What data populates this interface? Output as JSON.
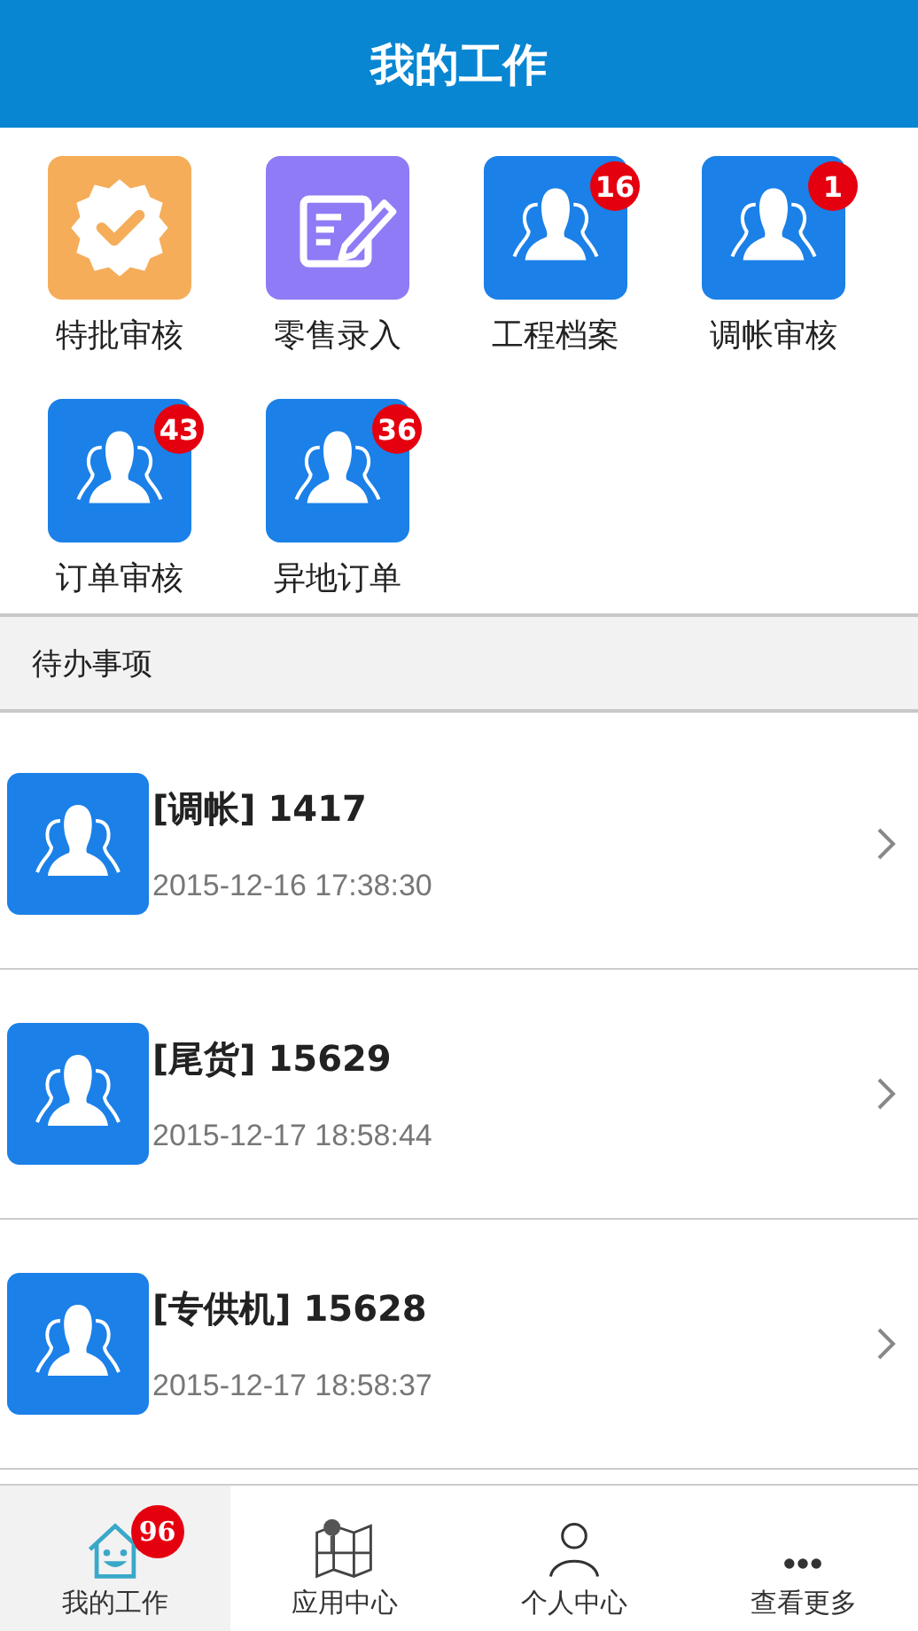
{
  "header": {
    "title": "我的工作"
  },
  "apps": [
    {
      "label": "特批审核",
      "kind": "approve"
    },
    {
      "label": "零售录入",
      "kind": "entry"
    },
    {
      "label": "工程档案",
      "kind": "people",
      "badge": "16"
    },
    {
      "label": "调帐审核",
      "kind": "people",
      "badge": "1"
    },
    {
      "label": "订单审核",
      "kind": "people",
      "badge": "43"
    },
    {
      "label": "异地订单",
      "kind": "people",
      "badge": "36"
    }
  ],
  "section": {
    "title": "待办事项"
  },
  "todos": [
    {
      "title": "[调帐] 1417",
      "time": "2015-12-16 17:38:30"
    },
    {
      "title": "[尾货] 15629",
      "time": "2015-12-17 18:58:44"
    },
    {
      "title": "[专供机] 15628",
      "time": "2015-12-17 18:58:37"
    }
  ],
  "tabbar": [
    {
      "label": "我的工作",
      "kind": "home",
      "selected": true,
      "badge": "96"
    },
    {
      "label": "应用中心",
      "kind": "map",
      "selected": false
    },
    {
      "label": "个人中心",
      "kind": "person",
      "selected": false
    },
    {
      "label": "查看更多",
      "kind": "more",
      "selected": false
    }
  ]
}
